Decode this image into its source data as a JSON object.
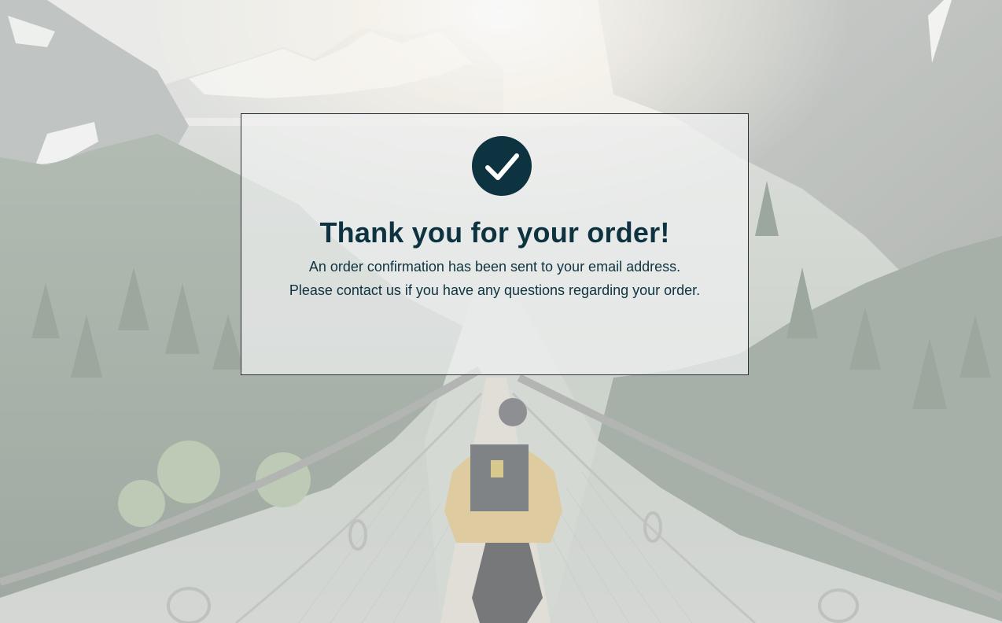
{
  "confirmation": {
    "icon": "check-circle-icon",
    "title": "Thank you for your order!",
    "message_line_1": "An order confirmation has been sent to your email address.",
    "message_line_2": "Please contact us if you have any questions regarding your order."
  },
  "colors": {
    "accent": "#0d3340",
    "modal_border": "#2a2f31",
    "modal_background": "#eef0f0"
  }
}
